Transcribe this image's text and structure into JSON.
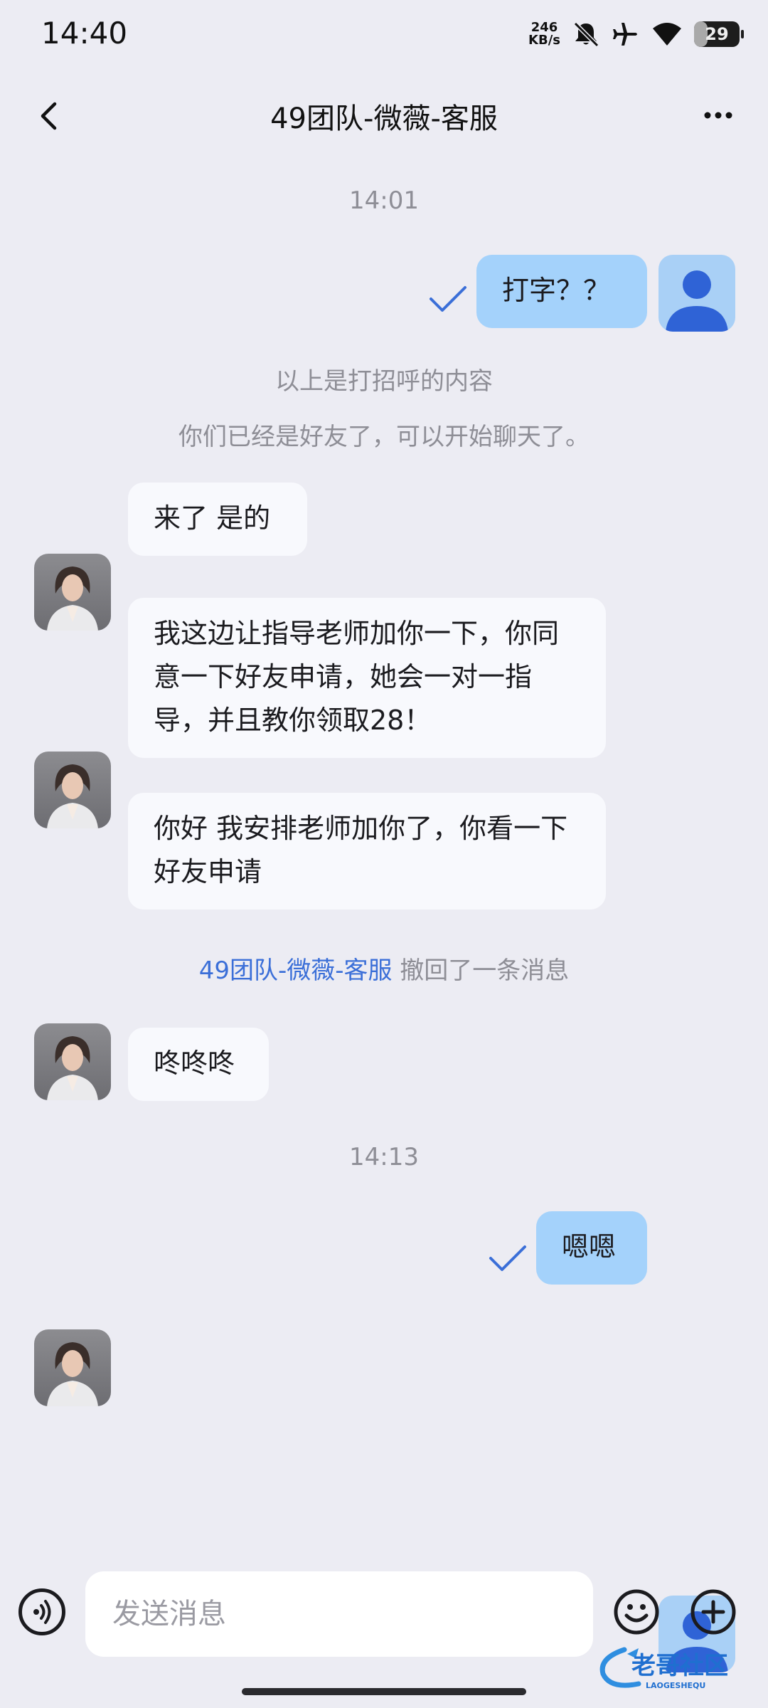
{
  "status_bar": {
    "time": "14:40",
    "net_speed_value": "246",
    "net_speed_unit": "KB/s",
    "battery_level": "29",
    "icons": [
      "mute-bell-icon",
      "airplane-icon",
      "wifi-icon",
      "battery-icon"
    ]
  },
  "header": {
    "title": "49团队-微薇-客服",
    "back_icon": "chevron-left-icon",
    "more_icon": "more-dots-icon"
  },
  "chat": {
    "time_1": "14:01",
    "msg_out_1": "打字？？",
    "sys_1": "以上是打招呼的内容",
    "sys_2": "你们已经是好友了，可以开始聊天了。",
    "msg_in_1": "来了 是的",
    "msg_in_2": "我这边让指导老师加你一下，你同意一下好友申请，她会一对一指导，并且教你领取28！",
    "msg_in_3": "你好 我安排老师加你了，你看一下好友申请",
    "recall_name": "49团队-微薇-客服",
    "recall_text": "撤回了一条消息",
    "msg_in_4": "咚咚咚",
    "time_2": "14:13",
    "msg_out_2": "嗯嗯"
  },
  "input_bar": {
    "placeholder": "发送消息",
    "value": "",
    "icons": [
      "voice-icon",
      "emoji-icon",
      "add-icon"
    ]
  },
  "watermark": {
    "text": "老哥社区",
    "sub": "LAOGESHEQU"
  },
  "colors": {
    "background": "#ececf3",
    "outgoing_bubble": "#a4d2fb",
    "incoming_bubble": "#f8f9fd",
    "accent": "#3b6fd8"
  }
}
